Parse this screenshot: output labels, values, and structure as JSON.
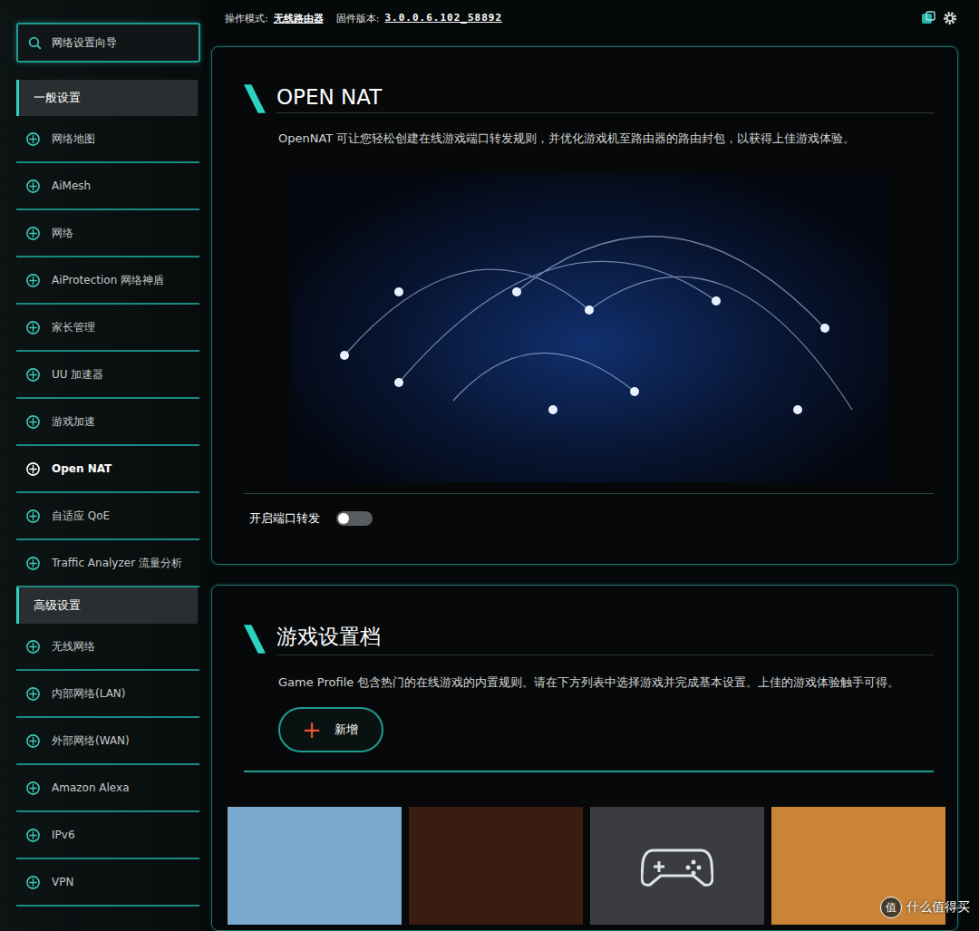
{
  "top_bar": {
    "mode_label": "操作模式:",
    "mode": "无线路由器",
    "firmware_label": "固件版本:",
    "firmware": "3.0.0.6.102_58892"
  },
  "sidebar": {
    "wizard": "网络设置向导",
    "sections": [
      {
        "title": "一般设置",
        "items": [
          {
            "label": "网络地图",
            "selected": false
          },
          {
            "label": "AiMesh",
            "selected": false
          },
          {
            "label": "网络",
            "selected": false
          },
          {
            "label": "AiProtection 网络神盾",
            "selected": false
          },
          {
            "label": "家长管理",
            "selected": false
          },
          {
            "label": "UU 加速器",
            "selected": false
          },
          {
            "label": "游戏加速",
            "selected": false
          },
          {
            "label": "Open NAT",
            "selected": true
          },
          {
            "label": "自适应 QoE",
            "selected": false
          },
          {
            "label": "Traffic Analyzer 流量分析",
            "selected": false
          }
        ]
      },
      {
        "title": "高级设置",
        "items": [
          {
            "label": "无线网络",
            "selected": false
          },
          {
            "label": "内部网络(LAN)",
            "selected": false
          },
          {
            "label": "外部网络(WAN)",
            "selected": false
          },
          {
            "label": "Amazon Alexa",
            "selected": false
          },
          {
            "label": "IPv6",
            "selected": false
          },
          {
            "label": "VPN",
            "selected": false
          }
        ]
      }
    ]
  },
  "open_nat": {
    "title": "OPEN NAT",
    "description": "OpenNAT 可让您轻松创建在线游戏端口转发规则，并优化游戏机至路由器的路由封包，以获得上佳游戏体验。",
    "port_forwarding": {
      "label": "开启端口转发",
      "on": false
    }
  },
  "game_profile": {
    "title": "游戏设置档",
    "description": "Game Profile 包含热门的在线游戏的内置规则。请在下方列表中选择游戏并完成基本设置。上佳的游戏体验触手可得。",
    "add_button": {
      "icon": "+",
      "label": "新增"
    },
    "cards": [
      {
        "kind": "image",
        "color": "#7aa9cf"
      },
      {
        "kind": "image",
        "color": "#3a1c10"
      },
      {
        "kind": "gamepad",
        "color": "#3a3c3f"
      },
      {
        "kind": "image",
        "color": "#c98436"
      }
    ]
  },
  "watermark": {
    "icon": "值",
    "text": "什么值得买"
  }
}
